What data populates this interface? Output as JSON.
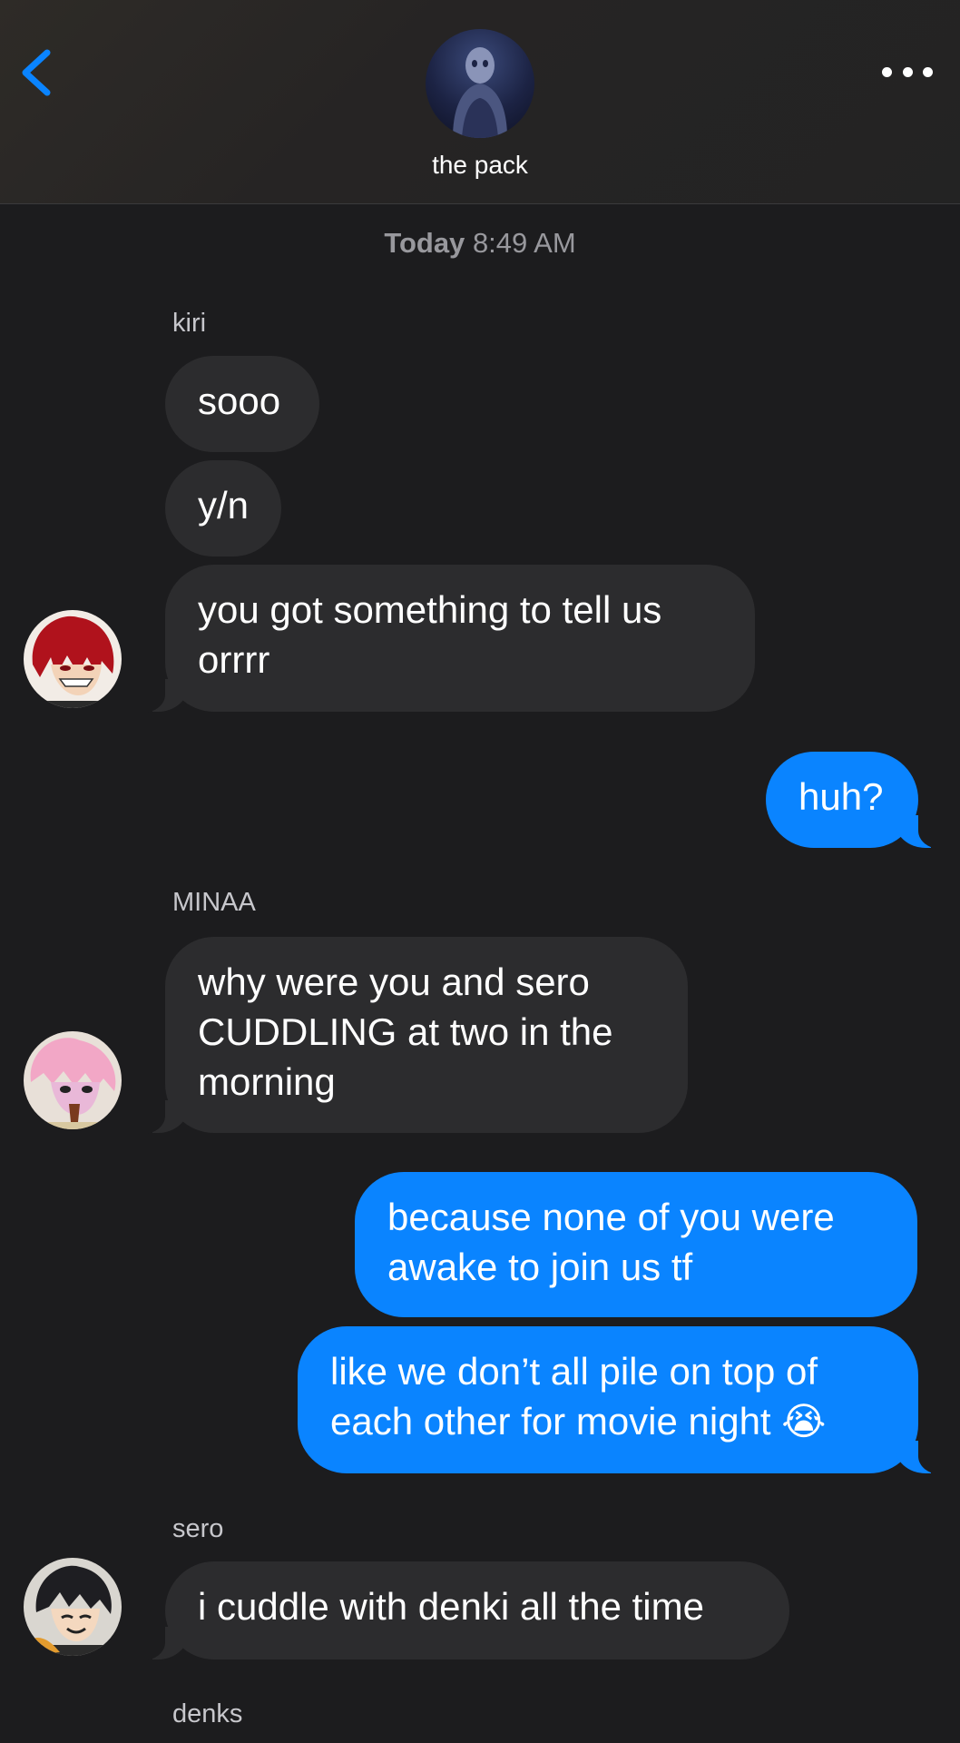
{
  "header": {
    "group_name": "the pack",
    "back_icon": "chevron-left-icon",
    "more_icon": "ellipsis-icon",
    "accent_color": "#0a84ff"
  },
  "timestamp": {
    "day": "Today",
    "time": "8:49 AM"
  },
  "senders": {
    "kiri": "kiri",
    "minaa": "MINAA",
    "sero": "sero",
    "denks": "denks"
  },
  "messages": [
    {
      "text": "sooo"
    },
    {
      "text": "y/n"
    },
    {
      "text": "you got something to tell us orrrr"
    },
    {
      "text": "huh?"
    },
    {
      "text": "why were you and sero CUDDLING at two in the morning"
    },
    {
      "text": "because none of you were awake to join us tf"
    },
    {
      "text": "like we don’t all pile on top of each other for movie night 😭"
    },
    {
      "text": "i cuddle with denki all the time"
    }
  ],
  "colors": {
    "background": "#1c1c1e",
    "incoming_bubble": "#2c2c2e",
    "outgoing_bubble": "#0a84ff"
  }
}
